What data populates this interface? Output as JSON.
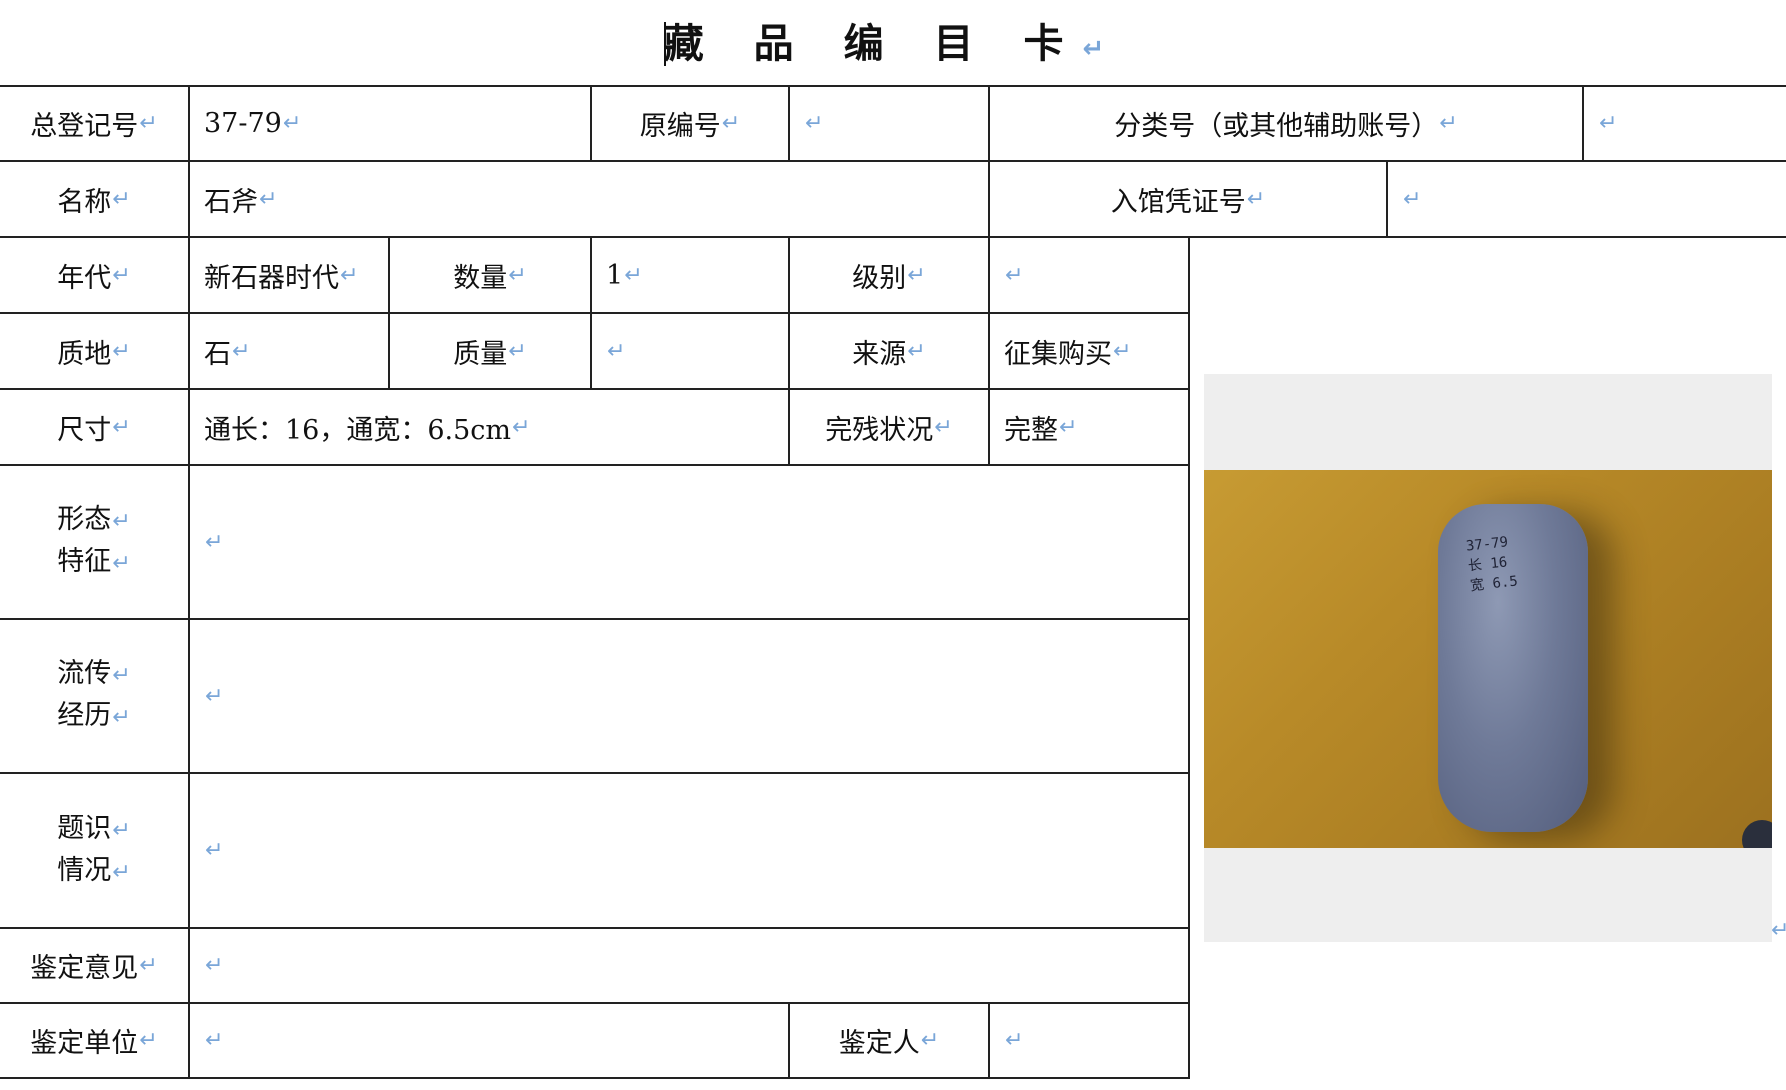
{
  "title": "藏 品 编 目 卡",
  "fields": {
    "reg_no_label": "总登记号",
    "reg_no_value": "37-79",
    "orig_no_label": "原编号",
    "orig_no_value": "",
    "class_no_label": "分类号（或其他辅助账号）",
    "class_no_value": "",
    "name_label": "名称",
    "name_value": "石斧",
    "voucher_label": "入馆凭证号",
    "voucher_value": "",
    "era_label": "年代",
    "era_value": "新石器时代",
    "qty_label": "数量",
    "qty_value": "1",
    "grade_label": "级别",
    "grade_value": "",
    "material_label": "质地",
    "material_value": "石",
    "mass_label": "质量",
    "mass_value": "",
    "source_label": "来源",
    "source_value": "征集购买",
    "size_label": "尺寸",
    "size_value": "通长：16，通宽：6.5cm",
    "condition_label": "完残状况",
    "condition_value": "完整",
    "form_label_1": "形态",
    "form_label_2": "特征",
    "form_value": "",
    "history_label_1": "流传",
    "history_label_2": "经历",
    "history_value": "",
    "inscription_label_1": "题识",
    "inscription_label_2": "情况",
    "inscription_value": "",
    "opinion_label": "鉴定意见",
    "opinion_value": "",
    "unit_label": "鉴定单位",
    "unit_value": "",
    "appraiser_label": "鉴定人",
    "appraiser_value": ""
  },
  "photo_caption": "37-79\n长 16\n宽 6.5"
}
